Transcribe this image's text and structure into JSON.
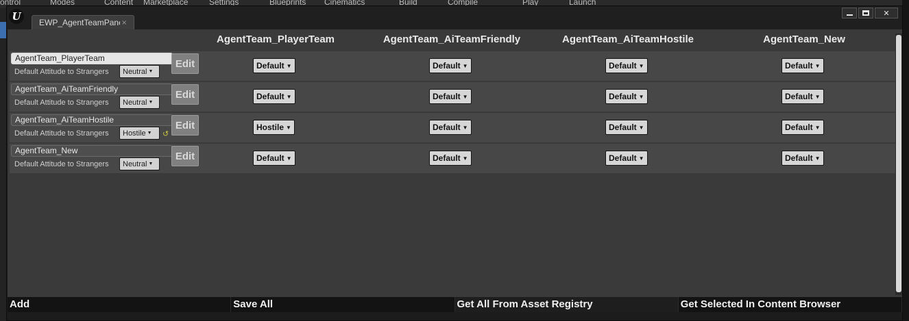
{
  "background_menu": [
    "ontrol",
    "Modes",
    "Content",
    "Marketplace",
    "Settings",
    "Blueprints",
    "Cinematics",
    "Build",
    "Compile",
    "Play",
    "Launch"
  ],
  "window": {
    "tab_label": "EWP_AgentTeamPane",
    "tab_close": "×",
    "controls": {
      "close": "✕"
    }
  },
  "columns": [
    "AgentTeam_PlayerTeam",
    "AgentTeam_AiTeamFriendly",
    "AgentTeam_AiTeamHostile",
    "AgentTeam_New"
  ],
  "rows": [
    {
      "team": "AgentTeam_PlayerTeam",
      "attitude_label": "Default Attitude to Strangers",
      "attitude": "Neutral",
      "edit": "Edit",
      "cells": [
        "Default",
        "Default",
        "Default",
        "Default"
      ]
    },
    {
      "team": "AgentTeam_AiTeamFriendly",
      "attitude_label": "Default Attitude to Strangers",
      "attitude": "Neutral",
      "edit": "Edit",
      "cells": [
        "Default",
        "Default",
        "Default",
        "Default"
      ]
    },
    {
      "team": "AgentTeam_AiTeamHostile",
      "attitude_label": "Default Attitude to Strangers",
      "attitude": "Hostile",
      "edit": "Edit",
      "cells": [
        "Hostile",
        "Default",
        "Default",
        "Default"
      ]
    },
    {
      "team": "AgentTeam_New",
      "attitude_label": "Default Attitude to Strangers",
      "attitude": "Neutral",
      "edit": "Edit",
      "cells": [
        "Default",
        "Default",
        "Default",
        "Default"
      ]
    }
  ],
  "bottom_buttons": [
    "Add",
    "Save All",
    "Get All From Asset Registry",
    "Get Selected In Content Browser"
  ]
}
